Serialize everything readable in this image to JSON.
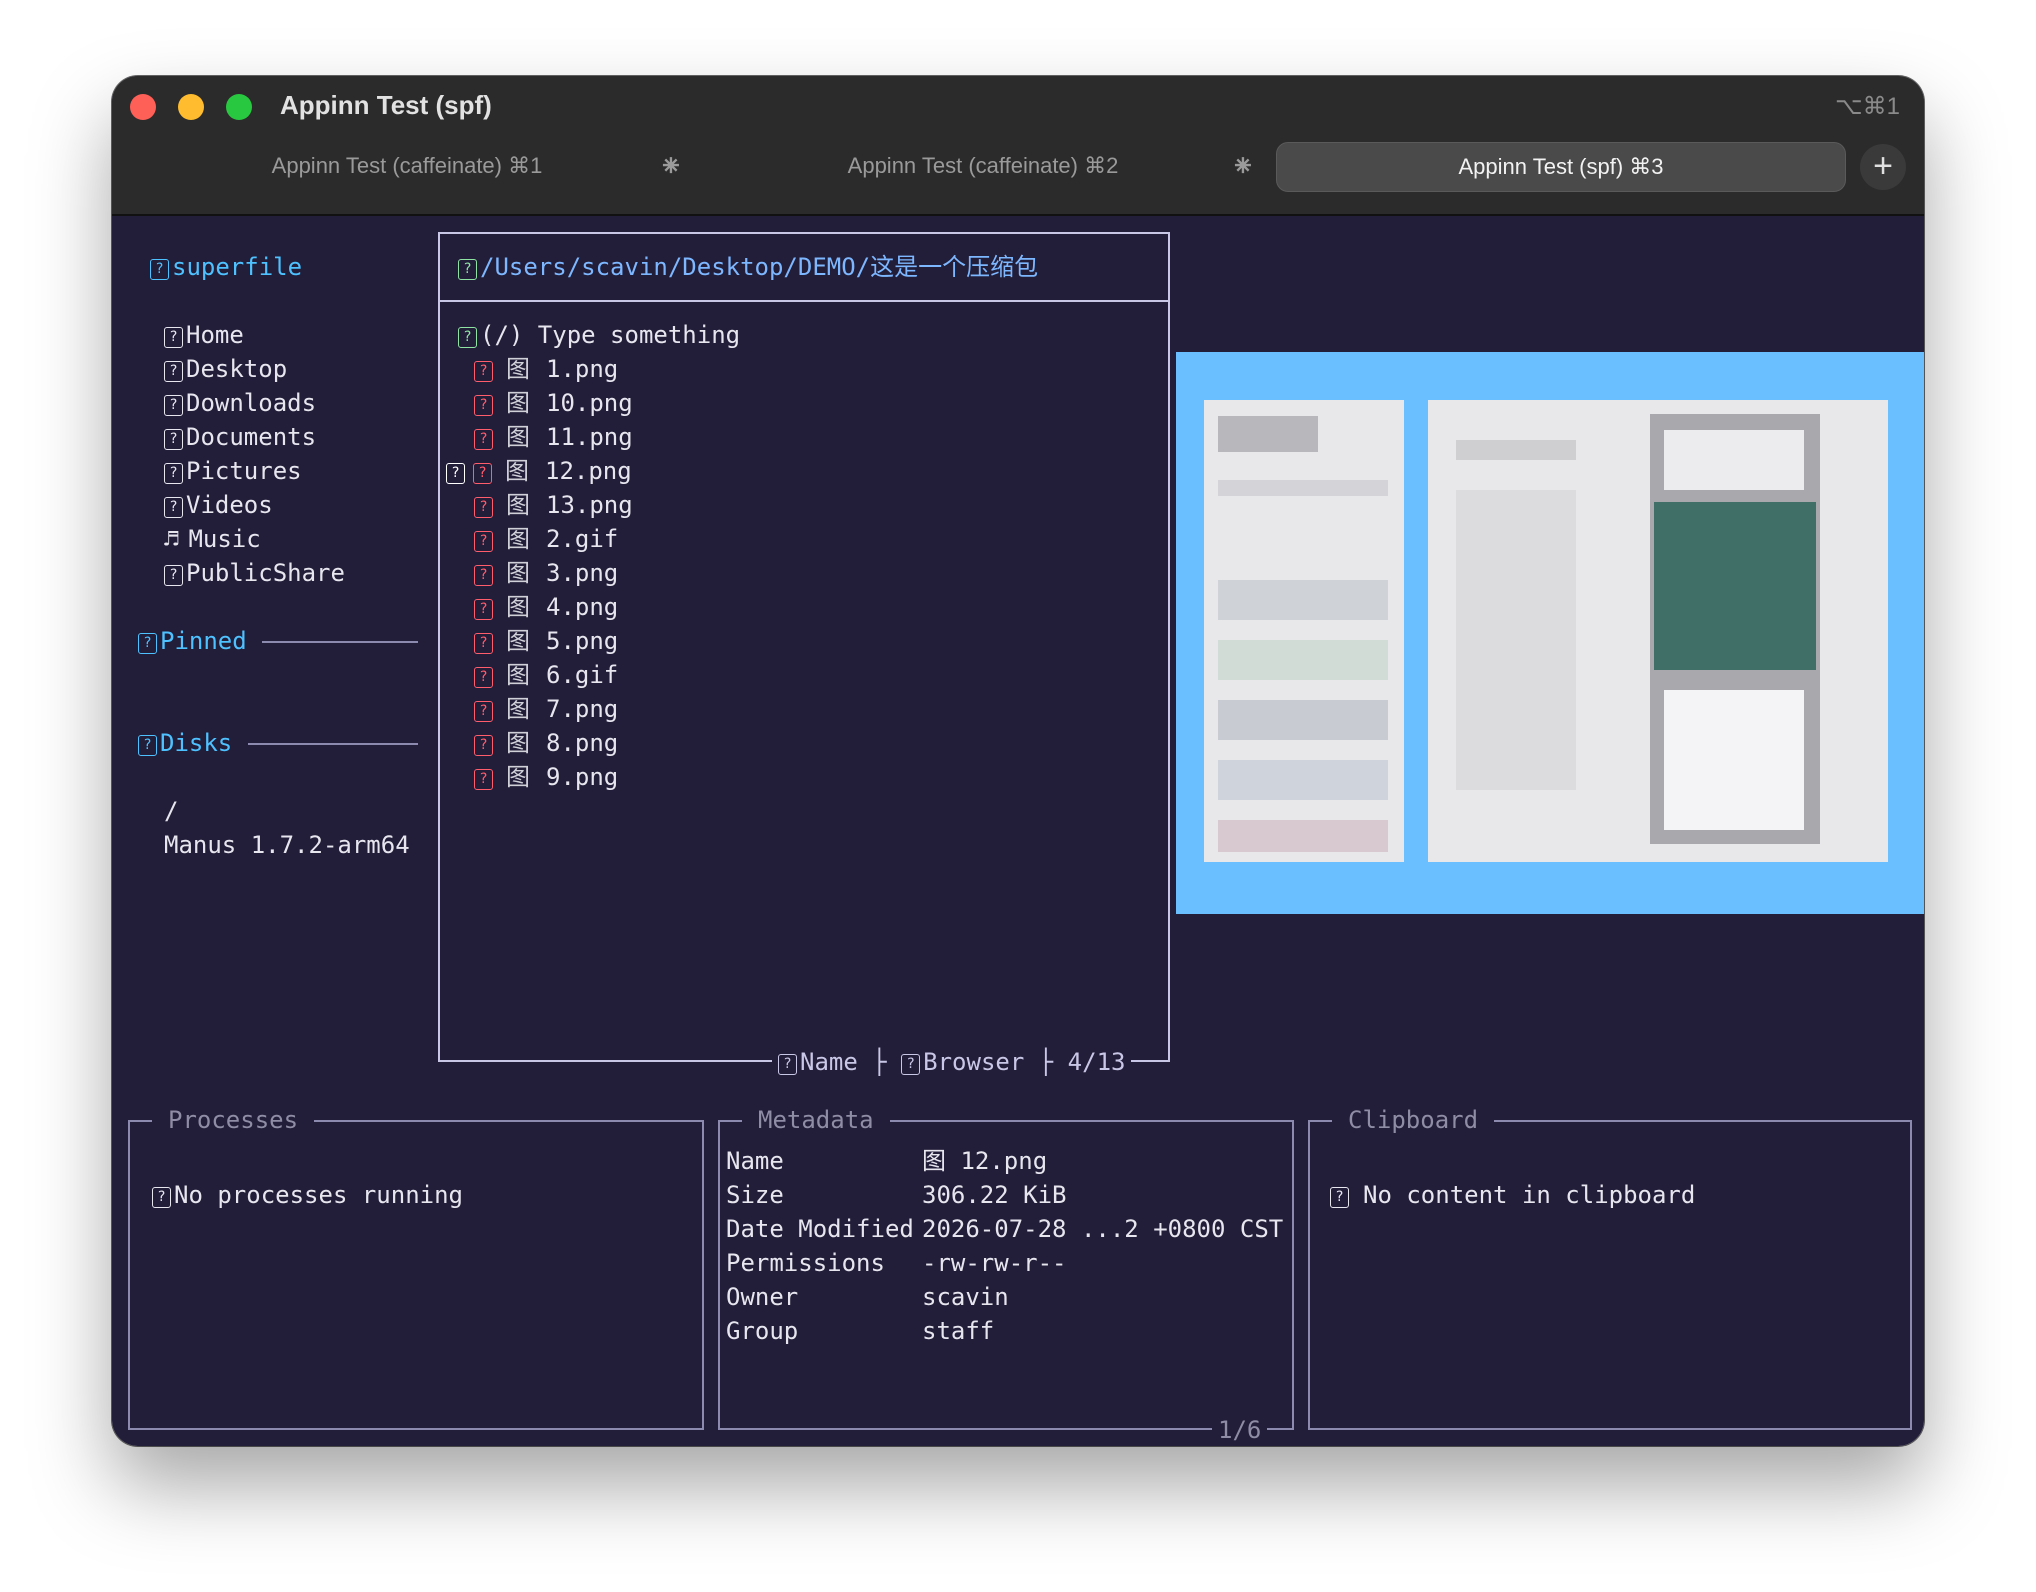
{
  "window": {
    "title": "Appinn Test (spf)",
    "shortcut": "⌥⌘1",
    "tabs": [
      {
        "label": "Appinn Test (caffeinate) ⌘1",
        "active": false
      },
      {
        "label": "Appinn Test (caffeinate) ⌘2",
        "active": false
      },
      {
        "label": "Appinn Test (spf) ⌘3",
        "active": true
      }
    ],
    "new_tab": "+"
  },
  "sidebar": {
    "title": "superfile",
    "items": [
      "Home",
      "Desktop",
      "Downloads",
      "Documents",
      "Pictures",
      "Videos",
      "Music",
      "PublicShare"
    ],
    "pinned_label": "Pinned",
    "disks_label": "Disks",
    "disks": [
      "/",
      "Manus 1.7.2-arm64"
    ]
  },
  "file_panel": {
    "path": "/Users/scavin/Desktop/DEMO/这是一个压缩包",
    "search_placeholder": "(/) Type something",
    "files": [
      "1.png",
      "10.png",
      "11.png",
      "12.png",
      "13.png",
      "2.gif",
      "3.png",
      "4.png",
      "5.png",
      "6.gif",
      "7.png",
      "8.png",
      "9.png"
    ],
    "selected_index": 3,
    "footer": {
      "sort": "Name",
      "mode": "Browser",
      "position": "4/13"
    }
  },
  "processes": {
    "title": "Processes",
    "message": "No processes running"
  },
  "metadata": {
    "title": "Metadata",
    "rows": [
      {
        "key": "Name",
        "value": "图 12.png"
      },
      {
        "key": "Size",
        "value": "306.22 KiB"
      },
      {
        "key": "Date Modified",
        "value": "2026-07-28 ...2 +0800 CST"
      },
      {
        "key": "Permissions",
        "value": "-rw-rw-r--"
      },
      {
        "key": "Owner",
        "value": "scavin"
      },
      {
        "key": "Group",
        "value": "staff"
      }
    ],
    "page": "1/6"
  },
  "clipboard": {
    "title": "Clipboard",
    "message": "No content in clipboard"
  },
  "icons": {
    "unknown_glyph": "?",
    "image_glyph": "图",
    "music_glyph": "♬"
  },
  "colors": {
    "background": "#221d38",
    "accent_cyan": "#4ec1ff",
    "file_icon_red": "#ff5c6c",
    "border": "#8d8ab0",
    "preview_bg": "#6ac0ff"
  }
}
